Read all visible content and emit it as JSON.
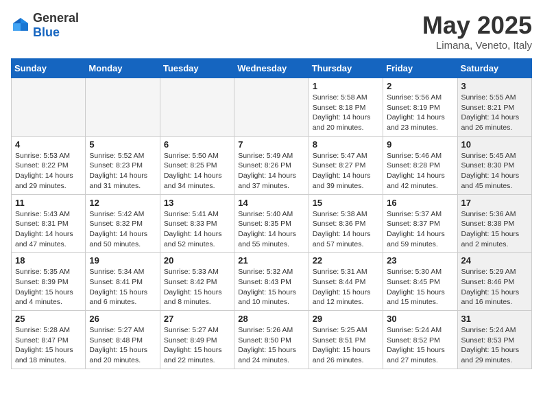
{
  "header": {
    "logo_general": "General",
    "logo_blue": "Blue",
    "title": "May 2025",
    "subtitle": "Limana, Veneto, Italy"
  },
  "days_of_week": [
    "Sunday",
    "Monday",
    "Tuesday",
    "Wednesday",
    "Thursday",
    "Friday",
    "Saturday"
  ],
  "weeks": [
    [
      {
        "day": "",
        "empty": true
      },
      {
        "day": "",
        "empty": true
      },
      {
        "day": "",
        "empty": true
      },
      {
        "day": "",
        "empty": true
      },
      {
        "day": "1",
        "sunrise": "Sunrise: 5:58 AM",
        "sunset": "Sunset: 8:18 PM",
        "daylight": "Daylight: 14 hours and 20 minutes."
      },
      {
        "day": "2",
        "sunrise": "Sunrise: 5:56 AM",
        "sunset": "Sunset: 8:19 PM",
        "daylight": "Daylight: 14 hours and 23 minutes."
      },
      {
        "day": "3",
        "sunrise": "Sunrise: 5:55 AM",
        "sunset": "Sunset: 8:21 PM",
        "daylight": "Daylight: 14 hours and 26 minutes.",
        "shaded": true
      }
    ],
    [
      {
        "day": "4",
        "sunrise": "Sunrise: 5:53 AM",
        "sunset": "Sunset: 8:22 PM",
        "daylight": "Daylight: 14 hours and 29 minutes."
      },
      {
        "day": "5",
        "sunrise": "Sunrise: 5:52 AM",
        "sunset": "Sunset: 8:23 PM",
        "daylight": "Daylight: 14 hours and 31 minutes."
      },
      {
        "day": "6",
        "sunrise": "Sunrise: 5:50 AM",
        "sunset": "Sunset: 8:25 PM",
        "daylight": "Daylight: 14 hours and 34 minutes."
      },
      {
        "day": "7",
        "sunrise": "Sunrise: 5:49 AM",
        "sunset": "Sunset: 8:26 PM",
        "daylight": "Daylight: 14 hours and 37 minutes."
      },
      {
        "day": "8",
        "sunrise": "Sunrise: 5:47 AM",
        "sunset": "Sunset: 8:27 PM",
        "daylight": "Daylight: 14 hours and 39 minutes."
      },
      {
        "day": "9",
        "sunrise": "Sunrise: 5:46 AM",
        "sunset": "Sunset: 8:28 PM",
        "daylight": "Daylight: 14 hours and 42 minutes."
      },
      {
        "day": "10",
        "sunrise": "Sunrise: 5:45 AM",
        "sunset": "Sunset: 8:30 PM",
        "daylight": "Daylight: 14 hours and 45 minutes.",
        "shaded": true
      }
    ],
    [
      {
        "day": "11",
        "sunrise": "Sunrise: 5:43 AM",
        "sunset": "Sunset: 8:31 PM",
        "daylight": "Daylight: 14 hours and 47 minutes."
      },
      {
        "day": "12",
        "sunrise": "Sunrise: 5:42 AM",
        "sunset": "Sunset: 8:32 PM",
        "daylight": "Daylight: 14 hours and 50 minutes."
      },
      {
        "day": "13",
        "sunrise": "Sunrise: 5:41 AM",
        "sunset": "Sunset: 8:33 PM",
        "daylight": "Daylight: 14 hours and 52 minutes."
      },
      {
        "day": "14",
        "sunrise": "Sunrise: 5:40 AM",
        "sunset": "Sunset: 8:35 PM",
        "daylight": "Daylight: 14 hours and 55 minutes."
      },
      {
        "day": "15",
        "sunrise": "Sunrise: 5:38 AM",
        "sunset": "Sunset: 8:36 PM",
        "daylight": "Daylight: 14 hours and 57 minutes."
      },
      {
        "day": "16",
        "sunrise": "Sunrise: 5:37 AM",
        "sunset": "Sunset: 8:37 PM",
        "daylight": "Daylight: 14 hours and 59 minutes."
      },
      {
        "day": "17",
        "sunrise": "Sunrise: 5:36 AM",
        "sunset": "Sunset: 8:38 PM",
        "daylight": "Daylight: 15 hours and 2 minutes.",
        "shaded": true
      }
    ],
    [
      {
        "day": "18",
        "sunrise": "Sunrise: 5:35 AM",
        "sunset": "Sunset: 8:39 PM",
        "daylight": "Daylight: 15 hours and 4 minutes."
      },
      {
        "day": "19",
        "sunrise": "Sunrise: 5:34 AM",
        "sunset": "Sunset: 8:41 PM",
        "daylight": "Daylight: 15 hours and 6 minutes."
      },
      {
        "day": "20",
        "sunrise": "Sunrise: 5:33 AM",
        "sunset": "Sunset: 8:42 PM",
        "daylight": "Daylight: 15 hours and 8 minutes."
      },
      {
        "day": "21",
        "sunrise": "Sunrise: 5:32 AM",
        "sunset": "Sunset: 8:43 PM",
        "daylight": "Daylight: 15 hours and 10 minutes."
      },
      {
        "day": "22",
        "sunrise": "Sunrise: 5:31 AM",
        "sunset": "Sunset: 8:44 PM",
        "daylight": "Daylight: 15 hours and 12 minutes."
      },
      {
        "day": "23",
        "sunrise": "Sunrise: 5:30 AM",
        "sunset": "Sunset: 8:45 PM",
        "daylight": "Daylight: 15 hours and 15 minutes."
      },
      {
        "day": "24",
        "sunrise": "Sunrise: 5:29 AM",
        "sunset": "Sunset: 8:46 PM",
        "daylight": "Daylight: 15 hours and 16 minutes.",
        "shaded": true
      }
    ],
    [
      {
        "day": "25",
        "sunrise": "Sunrise: 5:28 AM",
        "sunset": "Sunset: 8:47 PM",
        "daylight": "Daylight: 15 hours and 18 minutes."
      },
      {
        "day": "26",
        "sunrise": "Sunrise: 5:27 AM",
        "sunset": "Sunset: 8:48 PM",
        "daylight": "Daylight: 15 hours and 20 minutes."
      },
      {
        "day": "27",
        "sunrise": "Sunrise: 5:27 AM",
        "sunset": "Sunset: 8:49 PM",
        "daylight": "Daylight: 15 hours and 22 minutes."
      },
      {
        "day": "28",
        "sunrise": "Sunrise: 5:26 AM",
        "sunset": "Sunset: 8:50 PM",
        "daylight": "Daylight: 15 hours and 24 minutes."
      },
      {
        "day": "29",
        "sunrise": "Sunrise: 5:25 AM",
        "sunset": "Sunset: 8:51 PM",
        "daylight": "Daylight: 15 hours and 26 minutes."
      },
      {
        "day": "30",
        "sunrise": "Sunrise: 5:24 AM",
        "sunset": "Sunset: 8:52 PM",
        "daylight": "Daylight: 15 hours and 27 minutes."
      },
      {
        "day": "31",
        "sunrise": "Sunrise: 5:24 AM",
        "sunset": "Sunset: 8:53 PM",
        "daylight": "Daylight: 15 hours and 29 minutes.",
        "shaded": true
      }
    ]
  ]
}
